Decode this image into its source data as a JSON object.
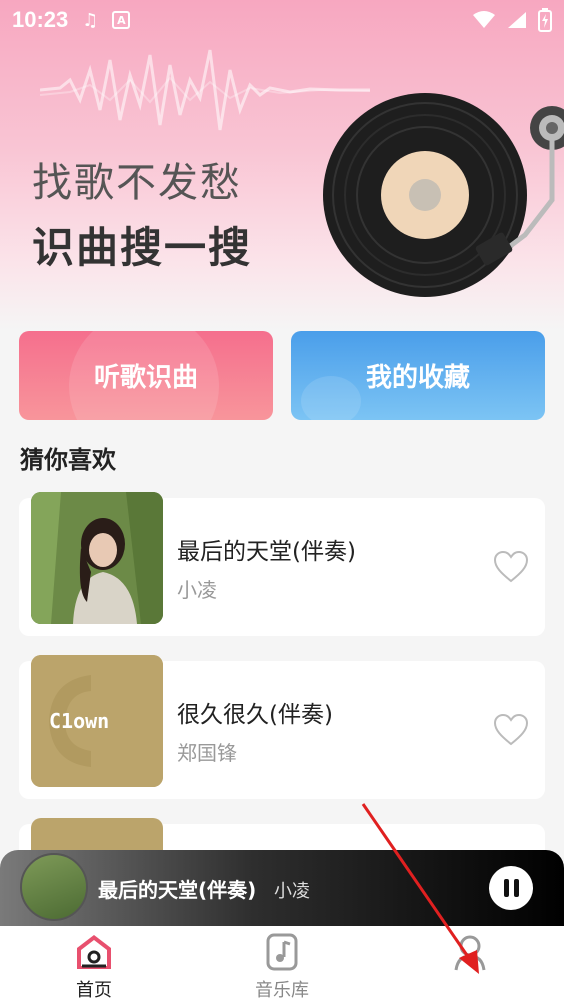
{
  "status_bar": {
    "time": "10:23",
    "icons": [
      "music-note-icon",
      "a-badge-icon",
      "wifi-icon",
      "signal-icon",
      "battery-icon"
    ]
  },
  "hero": {
    "line1": "找歌不发愁",
    "line2": "识曲搜一搜"
  },
  "actions": {
    "recognize_label": "听歌识曲",
    "favorites_label": "我的收藏"
  },
  "recommend": {
    "title": "猜你喜欢",
    "songs": [
      {
        "title": "最后的天堂(伴奏)",
        "artist": "小凌",
        "cover_text": ""
      },
      {
        "title": "很久很久(伴奏)",
        "artist": "郑国锋",
        "cover_text": "C1own"
      },
      {
        "title": "",
        "artist": "",
        "cover_text": ""
      }
    ]
  },
  "mini_player": {
    "title": "最后的天堂(伴奏)",
    "artist": "小凌",
    "state": "playing"
  },
  "tabs": [
    {
      "label": "首页",
      "icon": "home-icon",
      "active": true
    },
    {
      "label": "音乐库",
      "icon": "music-library-icon",
      "active": false
    },
    {
      "label": "",
      "icon": "profile-icon",
      "active": false
    }
  ],
  "colors": {
    "recognize_button": "#f56f8d",
    "favorites_button": "#4a9eea",
    "active_tab": "#e8506e",
    "annotation_arrow": "#e02020"
  }
}
